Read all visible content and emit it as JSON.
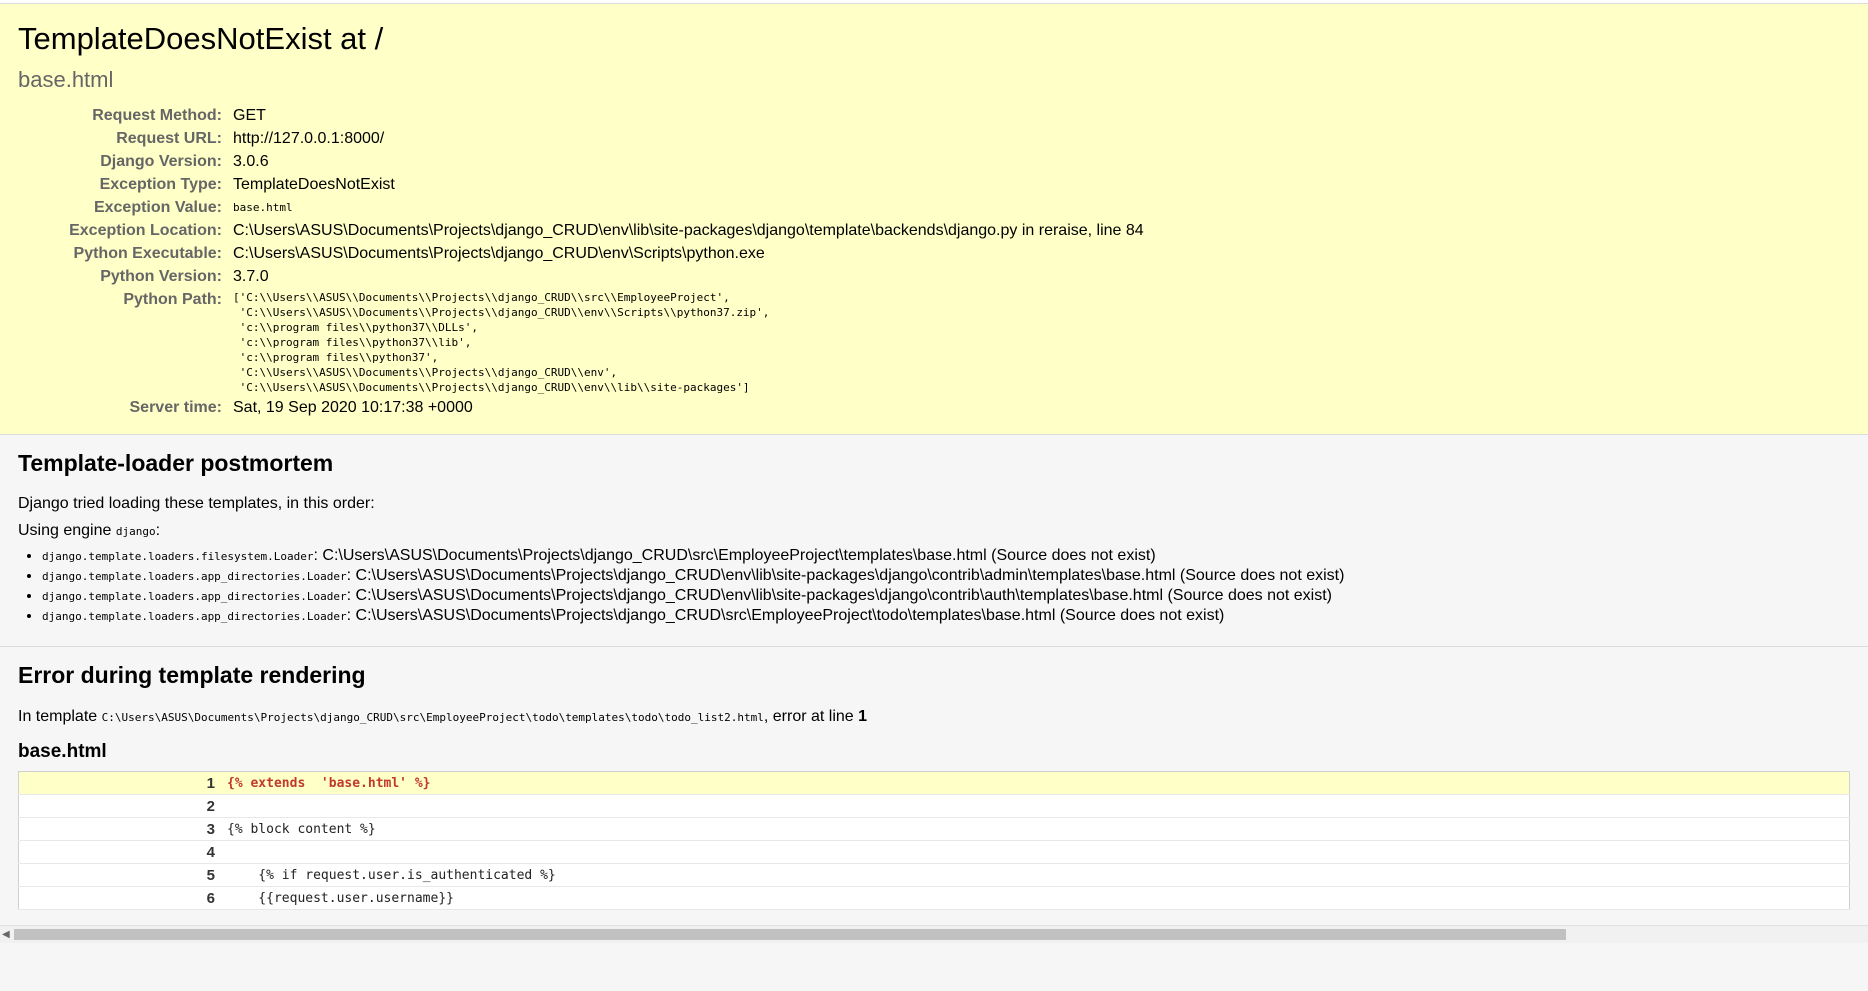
{
  "summary": {
    "title": "TemplateDoesNotExist at /",
    "subtitle": "base.html",
    "rows": [
      {
        "label": "Request Method:",
        "value": "GET"
      },
      {
        "label": "Request URL:",
        "value": "http://127.0.0.1:8000/"
      },
      {
        "label": "Django Version:",
        "value": "3.0.6"
      },
      {
        "label": "Exception Type:",
        "value": "TemplateDoesNotExist"
      },
      {
        "label": "Exception Value:",
        "value": "base.html"
      },
      {
        "label": "Exception Location:",
        "value": "C:\\Users\\ASUS\\Documents\\Projects\\django_CRUD\\env\\lib\\site-packages\\django\\template\\backends\\django.py in reraise, line 84"
      },
      {
        "label": "Python Executable:",
        "value": "C:\\Users\\ASUS\\Documents\\Projects\\django_CRUD\\env\\Scripts\\python.exe"
      },
      {
        "label": "Python Version:",
        "value": "3.7.0"
      },
      {
        "label": "Python Path:",
        "value": "['C:\\\\Users\\\\ASUS\\\\Documents\\\\Projects\\\\django_CRUD\\\\src\\\\EmployeeProject',\n 'C:\\\\Users\\\\ASUS\\\\Documents\\\\Projects\\\\django_CRUD\\\\env\\\\Scripts\\\\python37.zip',\n 'c:\\\\program files\\\\python37\\\\DLLs',\n 'c:\\\\program files\\\\python37\\\\lib',\n 'c:\\\\program files\\\\python37',\n 'C:\\\\Users\\\\ASUS\\\\Documents\\\\Projects\\\\django_CRUD\\\\env',\n 'C:\\\\Users\\\\ASUS\\\\Documents\\\\Projects\\\\django_CRUD\\\\env\\\\lib\\\\site-packages']"
      },
      {
        "label": "Server time:",
        "value": "Sat, 19 Sep 2020 10:17:38 +0000"
      }
    ]
  },
  "postmortem": {
    "heading": "Template-loader postmortem",
    "intro": "Django tried loading these templates, in this order:",
    "engine_prefix": "Using engine ",
    "engine_name": "django",
    "engine_suffix": ":",
    "loaders": [
      {
        "loader": "django.template.loaders.filesystem.Loader",
        "path": ": C:\\Users\\ASUS\\Documents\\Projects\\django_CRUD\\src\\EmployeeProject\\templates\\base.html (Source does not exist)"
      },
      {
        "loader": "django.template.loaders.app_directories.Loader",
        "path": ": C:\\Users\\ASUS\\Documents\\Projects\\django_CRUD\\env\\lib\\site-packages\\django\\contrib\\admin\\templates\\base.html (Source does not exist)"
      },
      {
        "loader": "django.template.loaders.app_directories.Loader",
        "path": ": C:\\Users\\ASUS\\Documents\\Projects\\django_CRUD\\env\\lib\\site-packages\\django\\contrib\\auth\\templates\\base.html (Source does not exist)"
      },
      {
        "loader": "django.template.loaders.app_directories.Loader",
        "path": ": C:\\Users\\ASUS\\Documents\\Projects\\django_CRUD\\src\\EmployeeProject\\todo\\templates\\base.html (Source does not exist)"
      }
    ]
  },
  "rendering": {
    "heading": "Error during template rendering",
    "in_template_prefix": "In template ",
    "template_path": "C:\\Users\\ASUS\\Documents\\Projects\\django_CRUD\\src\\EmployeeProject\\todo\\templates\\todo\\todo_list2.html",
    "error_at_prefix": ", error at line ",
    "error_line": "1",
    "source_title": "base.html",
    "lines": [
      {
        "num": "1",
        "code": "{% extends  'base.html' %}",
        "error": true
      },
      {
        "num": "2",
        "code": "",
        "error": false
      },
      {
        "num": "3",
        "code": "{% block content %}",
        "error": false
      },
      {
        "num": "4",
        "code": "",
        "error": false
      },
      {
        "num": "5",
        "code": "    {% if request.user.is_authenticated %}",
        "error": false
      },
      {
        "num": "6",
        "code": "    {{request.user.username}}",
        "error": false
      }
    ]
  },
  "scrollbar": {
    "position": 0,
    "visible_fraction": 0.84
  }
}
